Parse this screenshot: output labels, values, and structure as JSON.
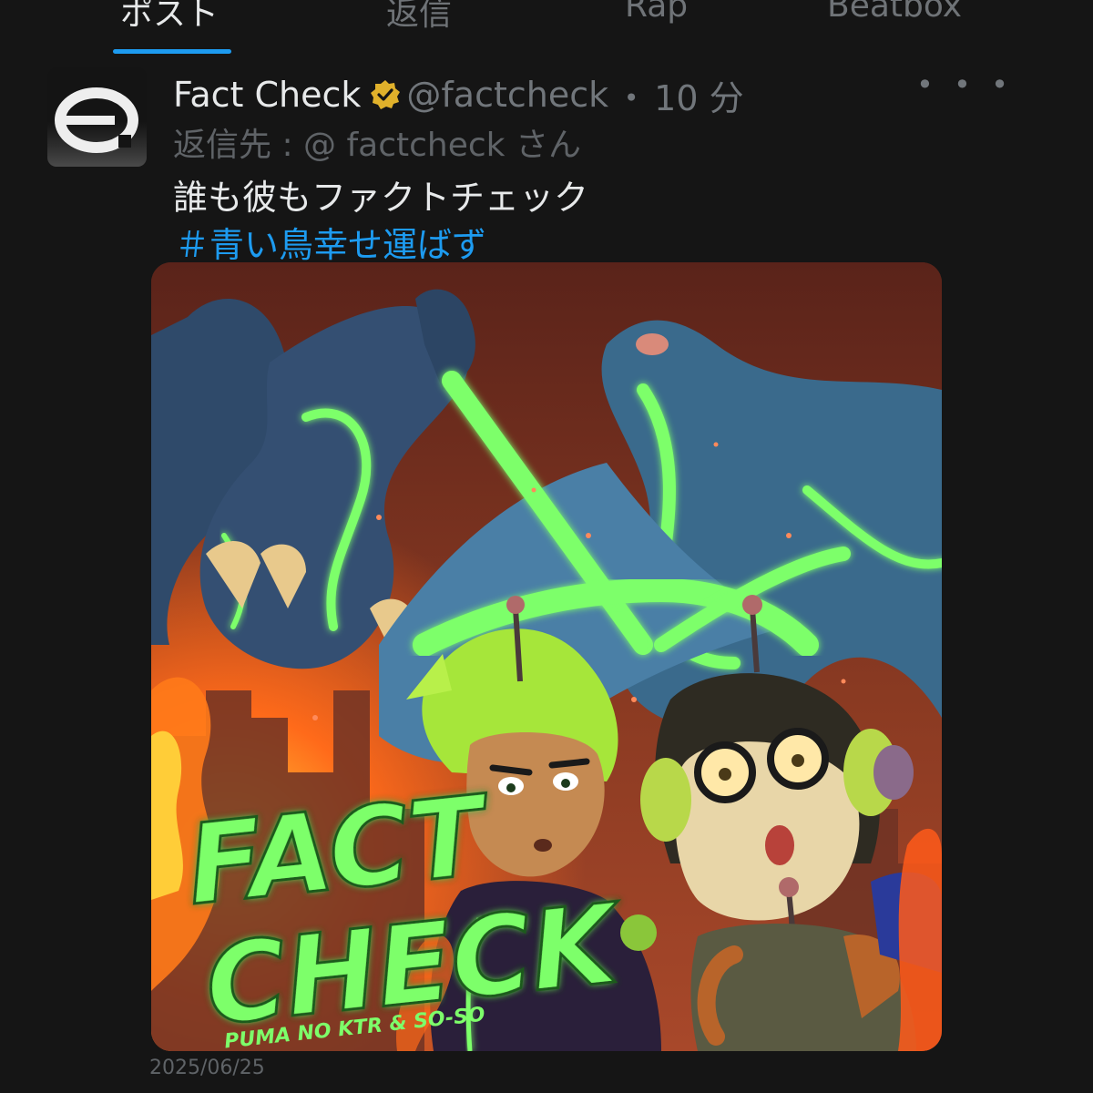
{
  "tabs": [
    {
      "label": "ポスト",
      "active": true
    },
    {
      "label": "返信",
      "active": false
    },
    {
      "label": "Rap",
      "active": false
    },
    {
      "label": "Beatbox",
      "active": false
    }
  ],
  "post": {
    "author": {
      "display_name": "Fact Check",
      "handle": "@factcheck",
      "verified_icon": "verified-badge-icon",
      "verified_color": "#e0b12b"
    },
    "separator": "・",
    "time": "10 分",
    "more_label": "• • •",
    "reply_to": "返信先 : @ factcheck さん",
    "text": "誰も彼もファクトチェック",
    "hashtag": "＃青い鳥幸せ運ばず",
    "media": {
      "title": "FACT CHECK",
      "title_line1": "FACT",
      "title_line2": "CHECK",
      "credit": "PUMA NO KTR & SO-SO"
    },
    "date": "2025/06/25"
  },
  "colors": {
    "accent": "#1d9bf0",
    "background": "#151515",
    "text": "#e7e9ea",
    "muted": "#71767b",
    "neon_green": "#7dff6a"
  }
}
